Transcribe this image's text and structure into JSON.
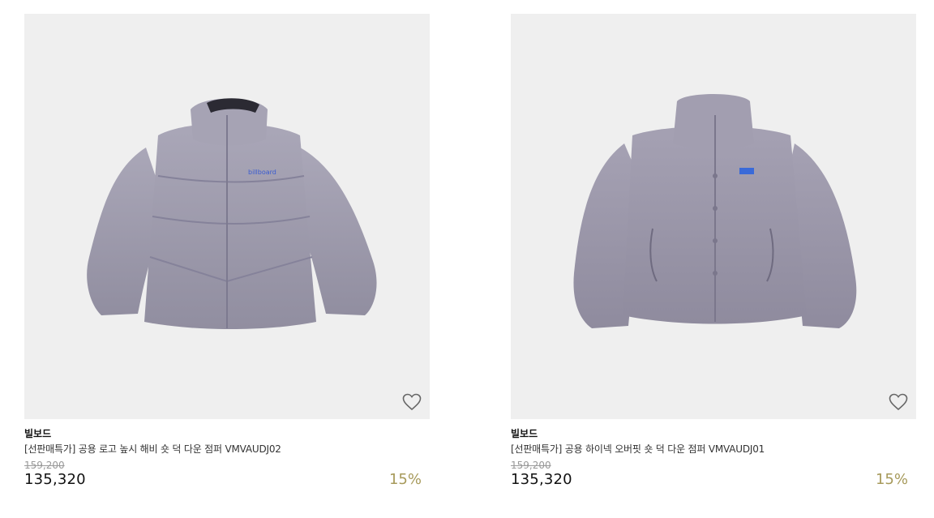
{
  "products": [
    {
      "brand": "빌보드",
      "name": "[선판매특가] 공용 로고 높시 해비 숏 덕 다운 점퍼 VMVAUDJ02",
      "original_price": "159,200",
      "sale_price": "135,320",
      "discount": "15%",
      "logo_text": "billboard",
      "jacket_color": "#9f9cae"
    },
    {
      "brand": "빌보드",
      "name": "[선판매특가] 공용 하이넥 오버핏 숏 덕 다운 점퍼 VMVAUDJ01",
      "original_price": "159,200",
      "sale_price": "135,320",
      "discount": "15%",
      "jacket_color": "#9b97a8"
    }
  ],
  "accent_colors": {
    "discount": "#a79a5b",
    "image_bg": "#efefef"
  }
}
